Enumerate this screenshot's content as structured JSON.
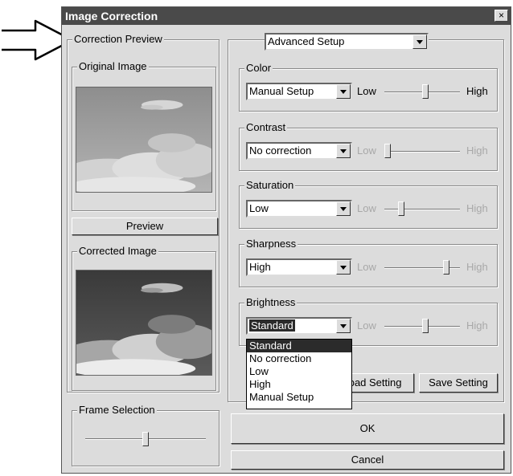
{
  "window": {
    "title": "Image Correction",
    "close": "×"
  },
  "left": {
    "preview_group": "Correction Preview",
    "original_group": "Original Image",
    "preview_button": "Preview",
    "corrected_group": "Corrected Image",
    "frame_group": "Frame Selection",
    "frame_slider": 0.5
  },
  "mode_select": {
    "value": "Advanced Setup"
  },
  "sliders": {
    "low": "Low",
    "high": "High",
    "color": {
      "label": "Color",
      "value": "Manual Setup",
      "level": 0.55
    },
    "contrast": {
      "label": "Contrast",
      "value": "No correction",
      "level": 0.0
    },
    "saturation": {
      "label": "Saturation",
      "value": "Low",
      "level": 0.2
    },
    "sharpness": {
      "label": "Sharpness",
      "value": "High",
      "level": 0.85
    },
    "brightness": {
      "label": "Brightness",
      "value": "Standard",
      "level": 0.55
    }
  },
  "dropdown_options": [
    "Standard",
    "No correction",
    "Low",
    "High",
    "Manual Setup"
  ],
  "buttons": {
    "load": "Load Setting",
    "save": "Save Setting",
    "ok": "OK",
    "cancel": "Cancel"
  },
  "colors": {
    "titlebar": "#4a4a4a",
    "face": "#dcdcdc",
    "selection": "#2b2b2b"
  }
}
